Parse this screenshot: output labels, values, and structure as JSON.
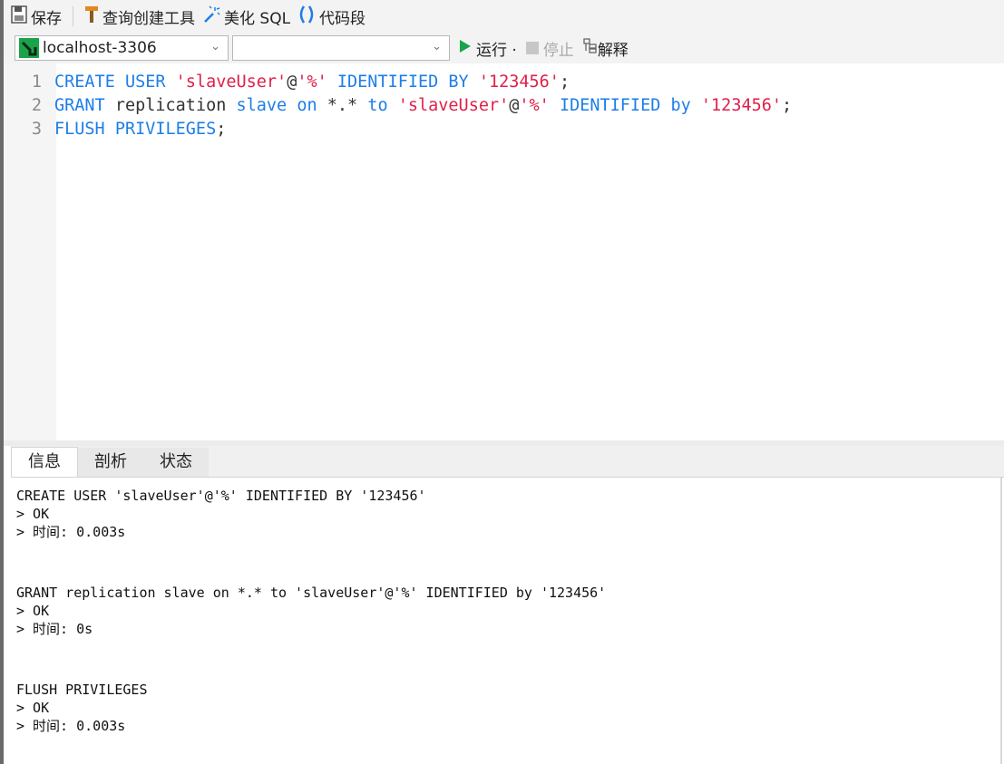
{
  "toolbar": {
    "save_label": "保存",
    "query_builder_label": "查询创建工具",
    "beautify_label": "美化 SQL",
    "snippet_label": "代码段"
  },
  "selector": {
    "connection": "localhost-3306",
    "database": "",
    "run_label": "运行 ·",
    "stop_label": "停止",
    "explain_label": "解释"
  },
  "editor": {
    "lines": [
      {
        "num": "1",
        "tokens": [
          {
            "t": "CREATE USER ",
            "c": "kw"
          },
          {
            "t": "'slaveUser'",
            "c": "str"
          },
          {
            "t": "@",
            "c": "pl"
          },
          {
            "t": "'%'",
            "c": "str"
          },
          {
            "t": " IDENTIFIED BY ",
            "c": "kw"
          },
          {
            "t": "'123456'",
            "c": "str"
          },
          {
            "t": ";",
            "c": "pl"
          }
        ]
      },
      {
        "num": "2",
        "tokens": [
          {
            "t": "GRANT",
            "c": "kw"
          },
          {
            "t": " replication ",
            "c": "pl"
          },
          {
            "t": "slave on",
            "c": "kw"
          },
          {
            "t": " *.* ",
            "c": "pl"
          },
          {
            "t": "to",
            "c": "kw"
          },
          {
            "t": " ",
            "c": "pl"
          },
          {
            "t": "'slaveUser'",
            "c": "str"
          },
          {
            "t": "@",
            "c": "pl"
          },
          {
            "t": "'%'",
            "c": "str"
          },
          {
            "t": " IDENTIFIED by ",
            "c": "kw"
          },
          {
            "t": "'123456'",
            "c": "str"
          },
          {
            "t": ";",
            "c": "pl"
          }
        ]
      },
      {
        "num": "3",
        "tokens": [
          {
            "t": "FLUSH PRIVILEGES",
            "c": "kw"
          },
          {
            "t": ";",
            "c": "pl"
          }
        ]
      }
    ]
  },
  "tabs": [
    "信息",
    "剖析",
    "状态"
  ],
  "output": {
    "blocks": [
      {
        "statement": "CREATE USER 'slaveUser'@'%' IDENTIFIED BY '123456'",
        "result": "> OK",
        "time": "> 时间: 0.003s"
      },
      {
        "statement": "GRANT replication slave on *.* to 'slaveUser'@'%' IDENTIFIED by '123456'",
        "result": "> OK",
        "time": "> 时间: 0s"
      },
      {
        "statement": "FLUSH PRIVILEGES",
        "result": "> OK",
        "time": "> 时间: 0.003s"
      }
    ]
  },
  "colors": {
    "keyword": "#1d7ee8",
    "string": "#e0204a",
    "run": "#1aa34a"
  }
}
